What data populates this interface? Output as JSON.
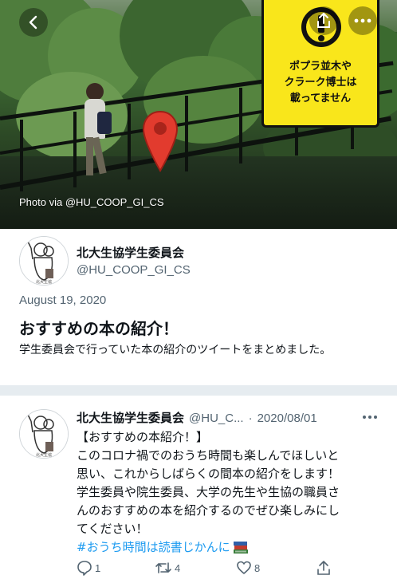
{
  "header": {
    "photo_credit": "Photo via @HU_COOP_GI_CS",
    "banner_lines": [
      "ポプラ並木や",
      "クラーク博士は",
      "載ってません"
    ],
    "back_icon": "chevron-left-icon",
    "share_icon": "share-icon",
    "more_icon": "more-icon"
  },
  "profile": {
    "name": "北大生協学生委員会",
    "handle": "@HU_COOP_GI_CS",
    "date": "August 19, 2020",
    "title": "おすすめの本の紹介！",
    "description": "学生委員会で行っていた本の紹介のツイートをまとめました。"
  },
  "tweet": {
    "name": "北大生協学生委員会",
    "handle": "@HU_C...",
    "separator": "·",
    "date": "2020/08/01",
    "body_lines": [
      "【おすすめの本紹介！】",
      "このコロナ禍でのおうち時間も楽しんでほしいと",
      "思い、これからしばらくの間本の紹介をします！",
      "学生委員や院生委員、大学の先生や生協の職員さ",
      "んのおすすめの本を紹介するのでぜひ楽しみにし",
      "てください！"
    ],
    "hashtag": "#おうち時間は読書じかんに",
    "replies": "1",
    "retweets": "4",
    "likes": "8"
  },
  "colors": {
    "accent_blue": "#1d9bf0",
    "banner_yellow": "#f9e61b",
    "secondary_text": "#536471",
    "divider": "#e6ecf0"
  }
}
